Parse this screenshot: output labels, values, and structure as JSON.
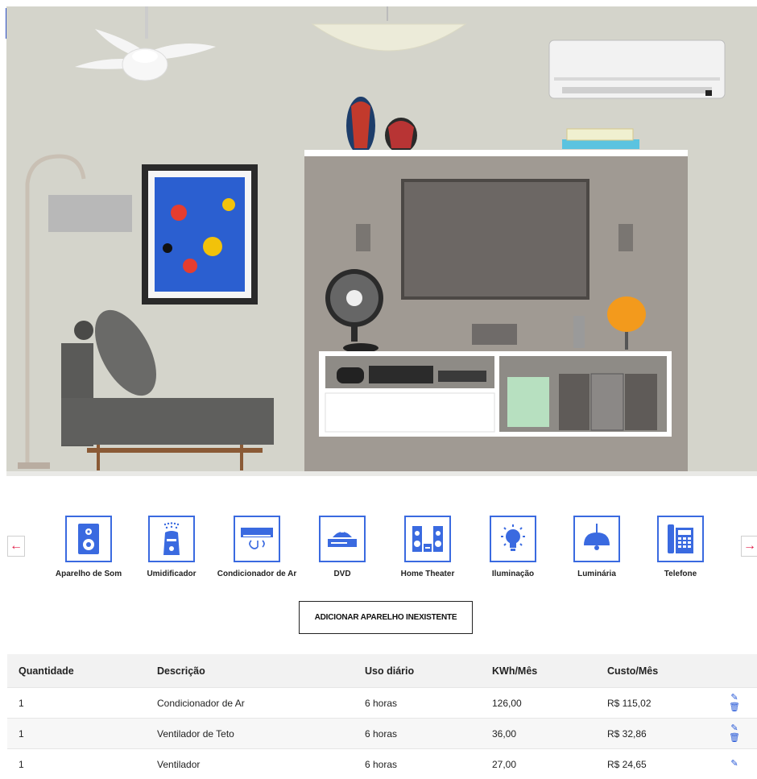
{
  "carousel": {
    "prev_label": "←",
    "next_label": "→",
    "items": [
      {
        "label": "Aparelho de Som",
        "icon": "speaker-icon"
      },
      {
        "label": "Umidificador",
        "icon": "humidifier-icon"
      },
      {
        "label": "Condicionador de Ar",
        "icon": "air-conditioner-icon"
      },
      {
        "label": "DVD",
        "icon": "dvd-icon"
      },
      {
        "label": "Home Theater",
        "icon": "home-theater-icon"
      },
      {
        "label": "Iluminação",
        "icon": "lightbulb-icon"
      },
      {
        "label": "Luminária",
        "icon": "pendant-lamp-icon"
      },
      {
        "label": "Telefone",
        "icon": "telephone-icon"
      }
    ]
  },
  "add_button": "ADICIONAR APARELHO INEXISTENTE",
  "table": {
    "headers": [
      "Quantidade",
      "Descrição",
      "Uso diário",
      "KWh/Mês",
      "Custo/Mês"
    ],
    "rows": [
      [
        "1",
        "Condicionador de Ar",
        "6 horas",
        "126,00",
        "R$ 115,02"
      ],
      [
        "1",
        "Ventilador de Teto",
        "6 horas",
        "36,00",
        "R$ 32,86"
      ],
      [
        "1",
        "Ventilador",
        "6 horas",
        "27,00",
        "R$ 24,65"
      ]
    ],
    "edit_icon": "✎",
    "delete_icon": "🗑"
  },
  "colors": {
    "accent": "#3a6ae0",
    "arrow": "#e11d48",
    "wall": "#d4d4cb"
  }
}
